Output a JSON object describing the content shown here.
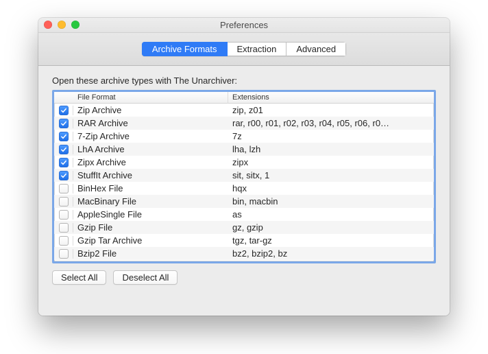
{
  "window": {
    "title": "Preferences"
  },
  "tabs": [
    {
      "label": "Archive Formats",
      "active": true
    },
    {
      "label": "Extraction",
      "active": false
    },
    {
      "label": "Advanced",
      "active": false
    }
  ],
  "instruction": "Open these archive types with The Unarchiver:",
  "columns": {
    "format": "File Format",
    "extensions": "Extensions"
  },
  "rows": [
    {
      "checked": true,
      "format": "Zip Archive",
      "extensions": "zip, z01"
    },
    {
      "checked": true,
      "format": "RAR Archive",
      "extensions": "rar, r00, r01, r02, r03, r04, r05, r06, r0…"
    },
    {
      "checked": true,
      "format": "7-Zip Archive",
      "extensions": "7z"
    },
    {
      "checked": true,
      "format": "LhA Archive",
      "extensions": "lha, lzh"
    },
    {
      "checked": true,
      "format": "Zipx Archive",
      "extensions": "zipx"
    },
    {
      "checked": true,
      "format": "StuffIt Archive",
      "extensions": "sit, sitx, 1"
    },
    {
      "checked": false,
      "format": "BinHex File",
      "extensions": "hqx"
    },
    {
      "checked": false,
      "format": "MacBinary File",
      "extensions": "bin, macbin"
    },
    {
      "checked": false,
      "format": "AppleSingle File",
      "extensions": "as"
    },
    {
      "checked": false,
      "format": "Gzip File",
      "extensions": "gz, gzip"
    },
    {
      "checked": false,
      "format": "Gzip Tar Archive",
      "extensions": "tgz, tar-gz"
    },
    {
      "checked": false,
      "format": "Bzip2 File",
      "extensions": "bz2, bzip2, bz"
    }
  ],
  "buttons": {
    "select_all": "Select All",
    "deselect_all": "Deselect All"
  }
}
